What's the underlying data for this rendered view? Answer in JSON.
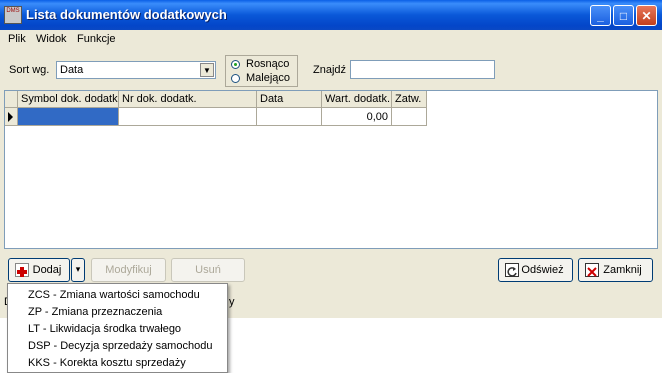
{
  "window": {
    "title": "Lista dokumentów dodatkowych",
    "app_icon_text": "DMS",
    "controls": {
      "minimize": "_",
      "maximize": "□",
      "close": "✕"
    }
  },
  "menu": [
    "Plik",
    "Widok",
    "Funkcje"
  ],
  "toolbar": {
    "sort_label": "Sort wg.",
    "sort_value": "Data",
    "radio_asc": "Rosnąco",
    "radio_desc": "Malejąco",
    "search_label": "Znajdź",
    "search_value": ""
  },
  "grid": {
    "columns": [
      "Symbol dok. dodatk.",
      "Nr dok. dodatk.",
      "Data",
      "Wart. dodatk.",
      "Zatw."
    ],
    "rows": [
      [
        "",
        "",
        "",
        "0,00",
        ""
      ]
    ]
  },
  "buttons": {
    "add": "Dodaj",
    "modify": "Modyfikuj",
    "delete": "Usuń",
    "refresh": "Odśwież",
    "close": "Zamknij"
  },
  "status_char": "D",
  "status_tail": "y",
  "dropdown_items": [
    "ZCS - Zmiana wartości samochodu",
    "ZP - Zmiana przeznaczenia",
    "LT - Likwidacja środka trwałego",
    "DSP - Decyzja sprzedaży samochodu",
    "KKS - Korekta kosztu sprzedaży"
  ],
  "colors": {
    "title_bar": "#0a58d8",
    "selection": "#316ac5",
    "face": "#ece9d8"
  }
}
